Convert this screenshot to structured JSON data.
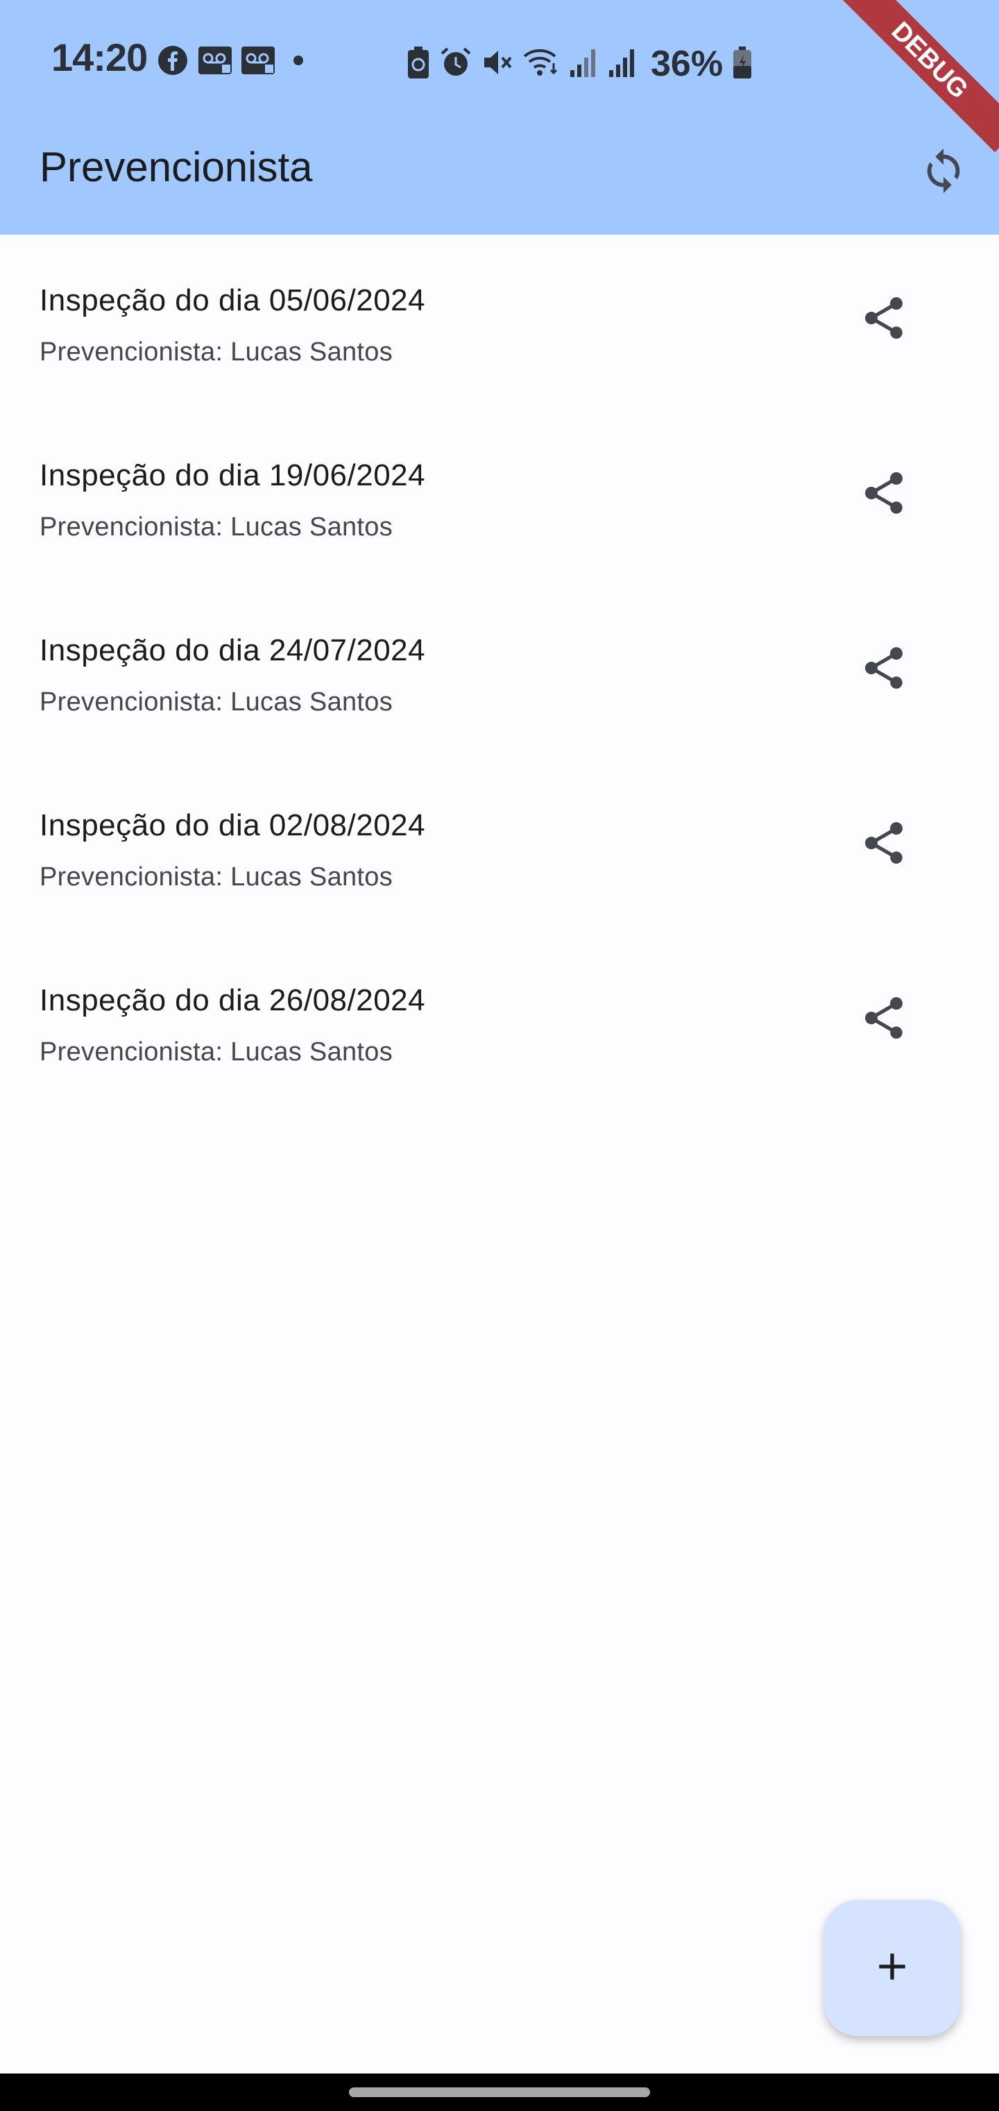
{
  "status_bar": {
    "time": "14:20",
    "battery_percent": "36%",
    "left_icons": [
      "facebook-icon",
      "voicemail-icon",
      "voicemail-icon",
      "dot-icon"
    ],
    "right_icons": [
      "battery-saver-icon",
      "alarm-icon",
      "mute-icon",
      "wifi-icon",
      "signal-icon",
      "signal-icon",
      "battery-icon"
    ]
  },
  "app_bar": {
    "title": "Prevencionista",
    "refresh_icon": "refresh-icon"
  },
  "debug_banner": {
    "label": "DEBUG"
  },
  "inspections": [
    {
      "title": "Inspeção do dia 05/06/2024",
      "subtitle": "Prevencionista: Lucas Santos"
    },
    {
      "title": "Inspeção do dia 19/06/2024",
      "subtitle": "Prevencionista: Lucas Santos"
    },
    {
      "title": "Inspeção do dia 24/07/2024",
      "subtitle": "Prevencionista: Lucas Santos"
    },
    {
      "title": "Inspeção do dia 02/08/2024",
      "subtitle": "Prevencionista: Lucas Santos"
    },
    {
      "title": "Inspeção do dia 26/08/2024",
      "subtitle": "Prevencionista: Lucas Santos"
    }
  ],
  "fab": {
    "icon": "plus-icon"
  },
  "colors": {
    "app_bar": "#a0c8ff",
    "background": "#fdfcff",
    "fab": "#d6e3ff",
    "debug_banner": "#b0383f",
    "icon": "#44474e"
  }
}
